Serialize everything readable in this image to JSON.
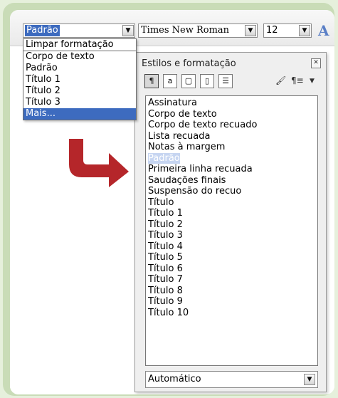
{
  "toolbar": {
    "style_value": "Padrão",
    "font_value": "Times New Roman",
    "size_value": "12"
  },
  "dropdown": {
    "items": [
      "Limpar formatação",
      "Corpo de texto",
      "Padrão",
      "Título 1",
      "Título 2",
      "Título 3",
      "Mais..."
    ]
  },
  "panel": {
    "title": "Estilos e formatação",
    "styles": [
      "Assinatura",
      "Corpo de texto",
      "Corpo de texto recuado",
      "Lista recuada",
      "Notas à margem",
      "Padrão",
      "Primeira linha recuada",
      "Saudações finais",
      "Suspensão do recuo",
      "Título",
      "Título 1",
      "Título 2",
      "Título 3",
      "Título 4",
      "Título 5",
      "Título 6",
      "Título 7",
      "Título 8",
      "Título 9",
      "Título 10"
    ],
    "selected_style": "Padrão",
    "filter_value": "Automático"
  },
  "colors": {
    "highlight": "#3d6bbf",
    "arrow": "#b5262a",
    "frame": "#c9dcb7"
  }
}
